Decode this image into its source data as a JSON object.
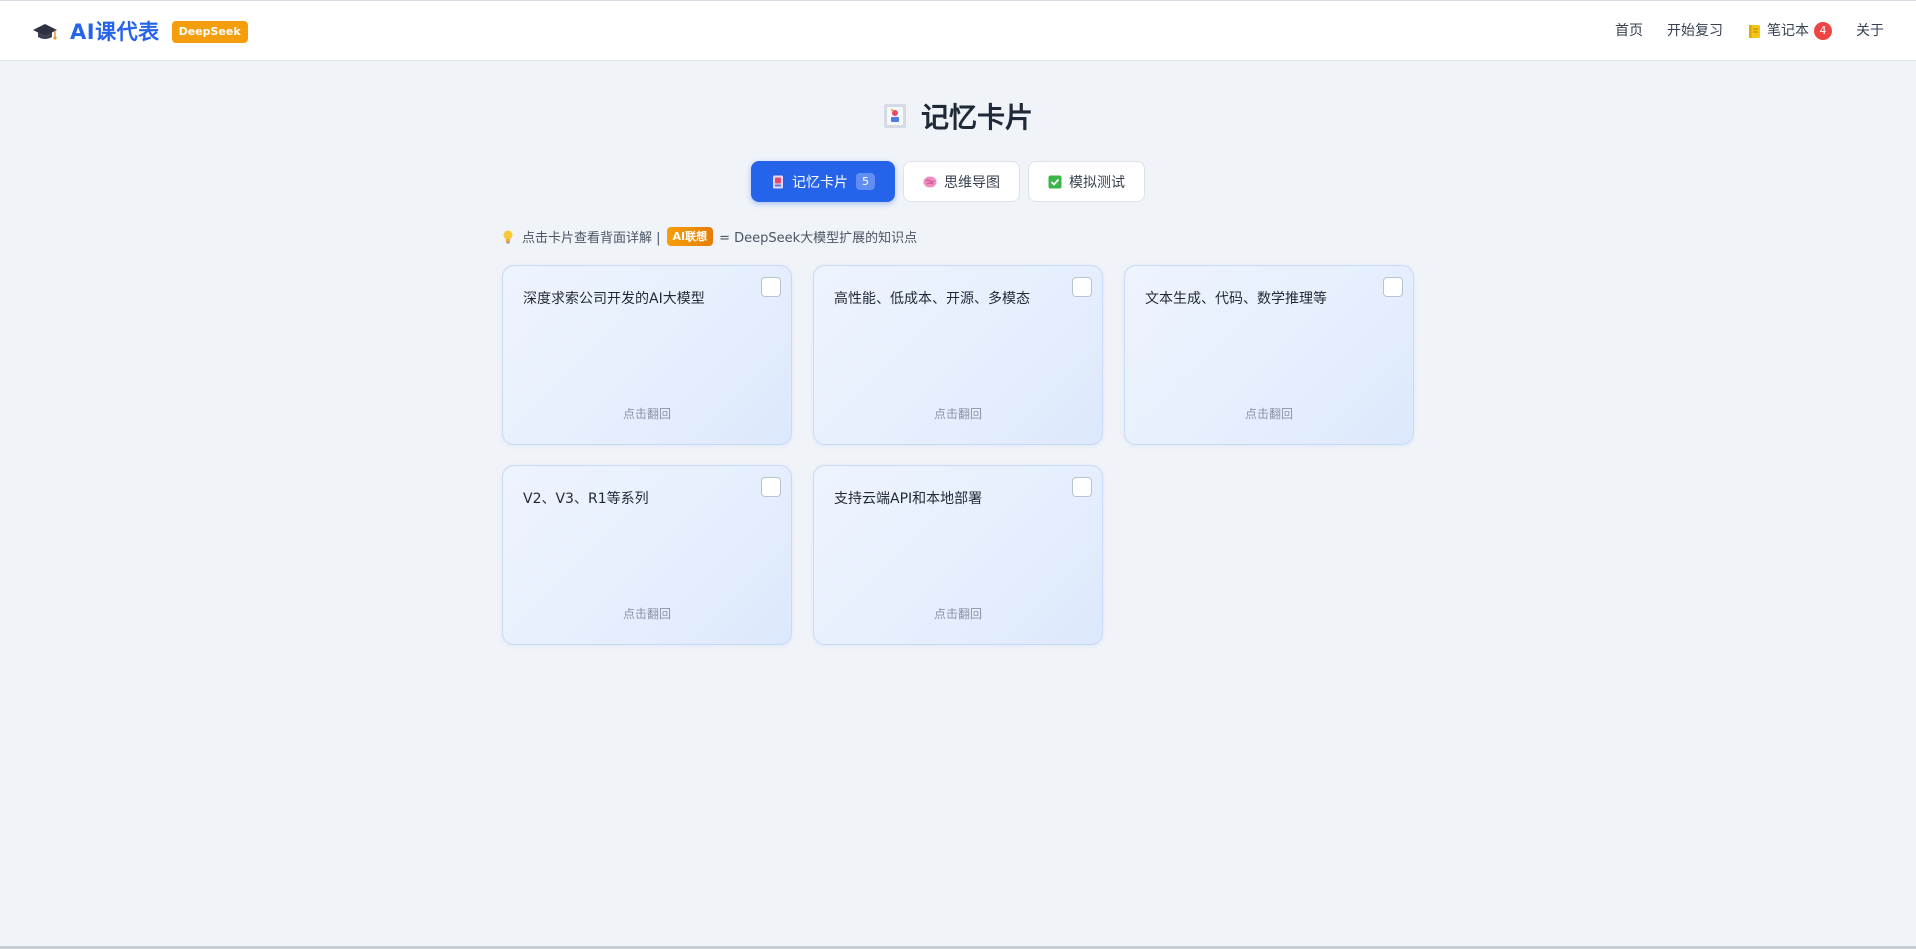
{
  "header": {
    "brand_title": "AI课代表",
    "brand_badge": "DeepSeek",
    "nav": {
      "home": "首页",
      "review": "开始复习",
      "notebook": "笔记本",
      "notebook_count": "4",
      "about": "关于"
    }
  },
  "page": {
    "title": "记忆卡片"
  },
  "tabs": [
    {
      "label": "记忆卡片",
      "count": "5",
      "active": true
    },
    {
      "label": "思维导图"
    },
    {
      "label": "模拟测试"
    }
  ],
  "hint": {
    "text_before": "点击卡片查看背面详解 |",
    "tag": "AI联想",
    "text_after": "= DeepSeek大模型扩展的知识点"
  },
  "cards": [
    {
      "text": "深度求索公司开发的AI大模型",
      "flip": "点击翻回"
    },
    {
      "text": "高性能、低成本、开源、多模态",
      "flip": "点击翻回"
    },
    {
      "text": "文本生成、代码、数学推理等",
      "flip": "点击翻回"
    },
    {
      "text": "V2、V3、R1等系列",
      "flip": "点击翻回"
    },
    {
      "text": "支持云端API和本地部署",
      "flip": "点击翻回"
    }
  ],
  "colors": {
    "primary": "#2563eb",
    "badge": "#f59e0b",
    "alert": "#ef4444",
    "background": "#f0f3f8"
  },
  "icons": {
    "brand": "graduation-cap-icon",
    "notebook": "notebook-icon",
    "title": "card-deck-icon",
    "tab_cards": "card-icon",
    "tab_mindmap": "brain-icon",
    "tab_quiz": "check-box-icon",
    "hint": "light-bulb-icon"
  }
}
